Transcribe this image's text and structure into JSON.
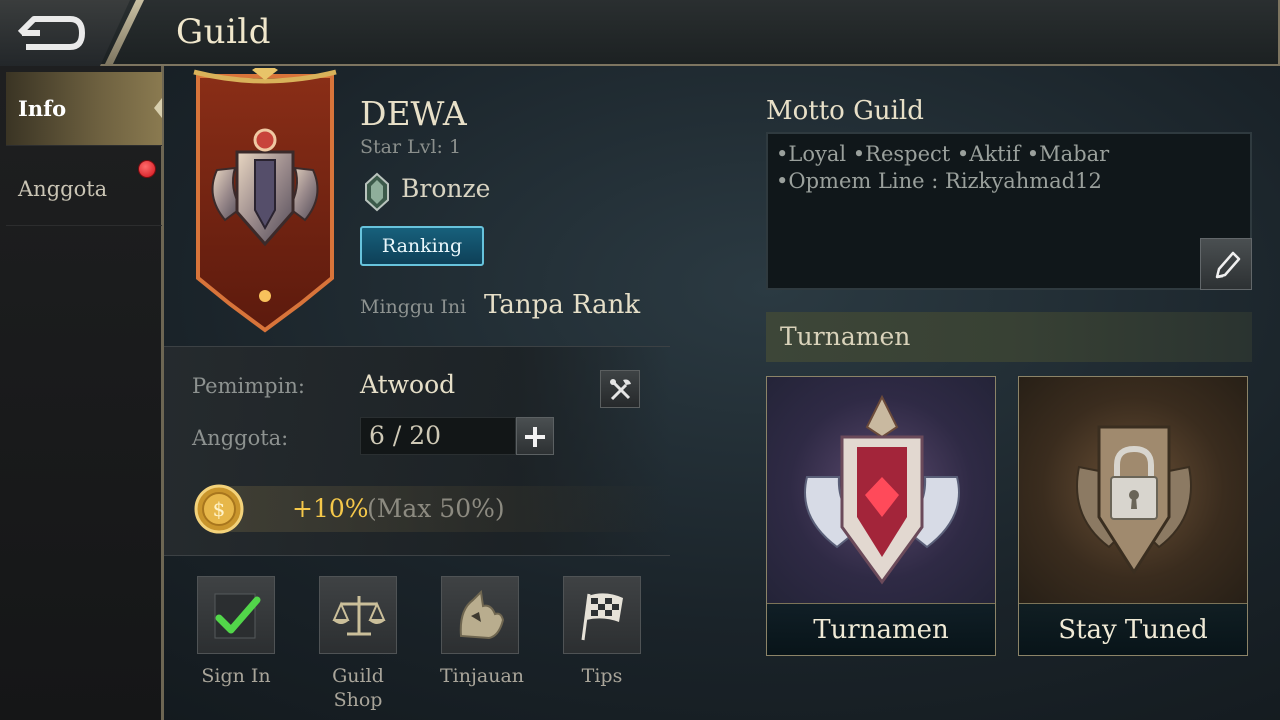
{
  "header": {
    "title": "Guild"
  },
  "sidebar": {
    "items": [
      {
        "label": "Info",
        "active": true
      },
      {
        "label": "Anggota",
        "notification": true
      }
    ]
  },
  "guild": {
    "name": "DEWA",
    "star_level": "Star Lvl: 1",
    "tier": "Bronze",
    "ranking_button": "Ranking",
    "week_label": "Minggu Ini",
    "week_rank": "Tanpa Rank",
    "leader_label": "Pemimpin:",
    "leader": "Atwood",
    "members_label": "Anggota:",
    "members": "6 / 20",
    "bonus": "+10%",
    "bonus_max": "(Max 50%)"
  },
  "actions": [
    {
      "label": "Sign In",
      "icon": "checkmark-icon"
    },
    {
      "label": "Guild Shop",
      "icon": "scales-icon"
    },
    {
      "label": "Tinjauan",
      "icon": "heroes-icon"
    },
    {
      "label": "Tips",
      "icon": "checkered-flag-icon"
    }
  ],
  "motto": {
    "title": "Motto Guild",
    "lines": [
      "•Loyal •Respect •Aktif •Mabar",
      "•Opmem Line : Rizkyahmad12"
    ]
  },
  "tournament": {
    "title": "Turnamen",
    "cards": [
      {
        "label": "Turnamen"
      },
      {
        "label": "Stay Tuned"
      }
    ]
  },
  "colors": {
    "accent_gold": "#f5c84a",
    "ranking_button": "#17607c",
    "notification_red": "#d0121b"
  }
}
